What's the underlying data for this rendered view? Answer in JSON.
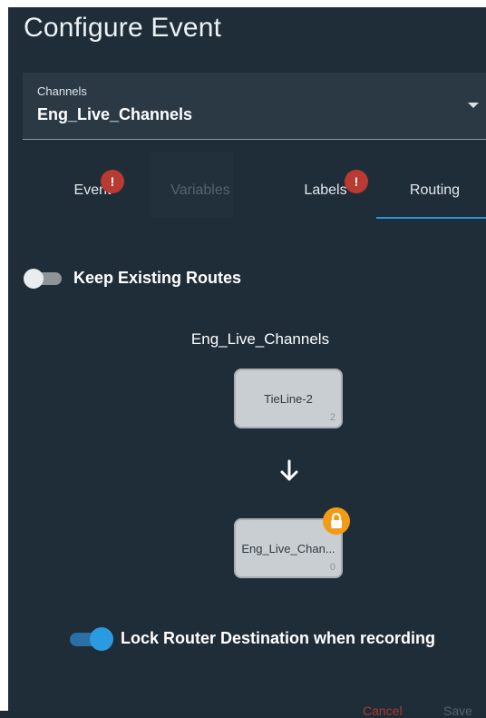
{
  "dialog": {
    "title": "Configure Event"
  },
  "channels_select": {
    "label": "Channels",
    "value": "Eng_Live_Channels",
    "icon": "caret-down-icon"
  },
  "tabs": [
    {
      "label": "Event",
      "badge": "!",
      "state": "error"
    },
    {
      "label": "Variables",
      "state": "disabled"
    },
    {
      "label": "Labels",
      "badge": "!",
      "state": "error"
    },
    {
      "label": "Routing",
      "state": "active"
    }
  ],
  "routing": {
    "keep_existing_routes": {
      "label": "Keep Existing Routes",
      "on": false
    },
    "channel_name": "Eng_Live_Channels",
    "source_node": {
      "name": "TieLine-2",
      "count": "2"
    },
    "destination_node": {
      "name": "Eng_Live_Chan...",
      "count": "0",
      "locked": true,
      "badge_icon": "lock-icon"
    },
    "lock_destination": {
      "label": "Lock Router Destination when recording",
      "on": true
    }
  },
  "footer": {
    "cancel_label": "Cancel",
    "save_label": "Save"
  },
  "colors": {
    "accent": "#2797dc",
    "error": "#b83a32",
    "lock": "#f39b15",
    "background": "#1f2d38"
  }
}
